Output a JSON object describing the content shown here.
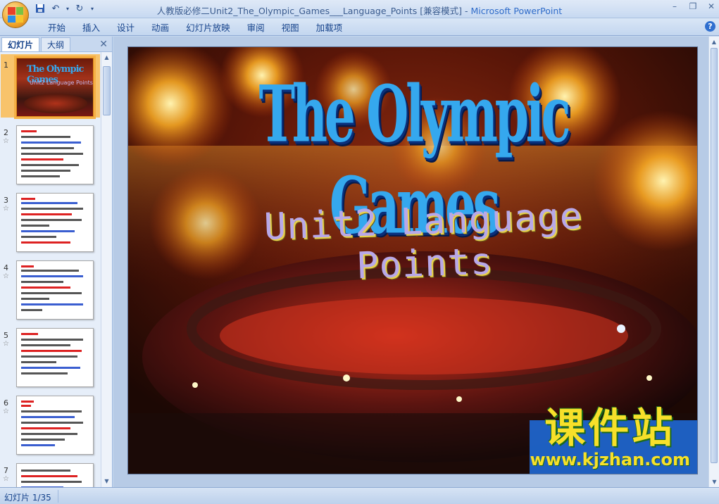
{
  "window": {
    "title_doc": "人教版必修二Unit2_The_Olympic_Games___Language_Points [兼容模式] - ",
    "title_app": "Microsoft PowerPoint"
  },
  "ribbon": {
    "tabs": [
      "开始",
      "插入",
      "设计",
      "动画",
      "幻灯片放映",
      "审阅",
      "视图",
      "加载项"
    ]
  },
  "left_panel": {
    "tab_slides": "幻灯片",
    "tab_outline": "大纲",
    "close_glyph": "✕",
    "thumbnails": [
      {
        "num": "1",
        "star": ""
      },
      {
        "num": "2",
        "star": "☆"
      },
      {
        "num": "3",
        "star": "☆"
      },
      {
        "num": "4",
        "star": "☆"
      },
      {
        "num": "5",
        "star": "☆"
      },
      {
        "num": "6",
        "star": "☆"
      },
      {
        "num": "7",
        "star": "☆"
      }
    ]
  },
  "slide": {
    "title": "The Olympic Games",
    "subtitle": "Unit2 Language Points",
    "watermark_main": "课件站",
    "watermark_url": "www.kjzhan.com"
  },
  "status": {
    "slide_counter": "幻灯片 1/35"
  },
  "colors": {
    "ribbon_text": "#15428b",
    "title_blue": "#35a8ee",
    "selection": "#f5b046"
  }
}
